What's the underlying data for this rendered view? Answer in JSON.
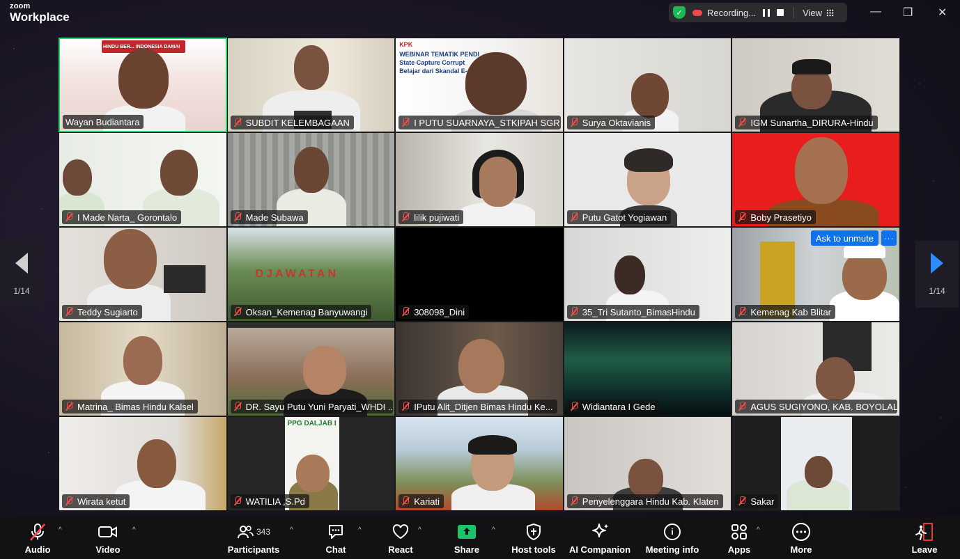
{
  "app": {
    "brand_top": "zoom",
    "brand_bottom": "Workplace"
  },
  "recording": {
    "status": "Recording...",
    "view_label": "View"
  },
  "window_controls": {
    "minimize": "—",
    "restore": "❐",
    "close": "✕"
  },
  "pager": {
    "left": "1/14",
    "right": "1/14"
  },
  "participants": [
    {
      "name": "Wayan Budiantara",
      "active": true,
      "muted": false
    },
    {
      "name": "SUBDIT KELEMBAGAAN",
      "muted": true
    },
    {
      "name": "I PUTU SUARNAYA_STKIPAH SGR",
      "muted": true
    },
    {
      "name": "Surya Oktavianis",
      "muted": true
    },
    {
      "name": "IGM Sunartha_DIRURA-Hindu",
      "muted": true
    },
    {
      "name": "I Made Narta_ Gorontalo",
      "muted": true
    },
    {
      "name": "Made Subawa",
      "muted": true
    },
    {
      "name": "lilik pujiwati",
      "muted": true
    },
    {
      "name": "Putu Gatot Yogiawan",
      "muted": true
    },
    {
      "name": "Boby Prasetiyo",
      "muted": true
    },
    {
      "name": "Teddy Sugiarto",
      "muted": true
    },
    {
      "name": "Oksan_Kemenag Banyuwangi",
      "muted": true
    },
    {
      "name": "308098_Dini",
      "muted": true
    },
    {
      "name": "35_Tri Sutanto_BimasHindu",
      "muted": true
    },
    {
      "name": "Kemenag Kab Blitar",
      "muted": true
    },
    {
      "name": "Matrina_ Bimas Hindu Kalsel",
      "muted": true
    },
    {
      "name": "DR. Sayu Putu Yuni Paryati_WHDI ...",
      "muted": true
    },
    {
      "name": "IPutu Alit_Ditjen Bimas Hindu Ke...",
      "muted": true
    },
    {
      "name": "Widiantara I Gede",
      "muted": true
    },
    {
      "name": "AGUS SUGIYONO, KAB. BOYOLALI",
      "muted": true
    },
    {
      "name": "Wirata ketut",
      "muted": true
    },
    {
      "name": "WATILIA ,S.Pd",
      "muted": true
    },
    {
      "name": "Kariati",
      "muted": true
    },
    {
      "name": "Penyelenggara Hindu Kab. Klaten",
      "muted": true
    },
    {
      "name": "Sakar",
      "muted": true
    }
  ],
  "tile_overlays": {
    "ask_unmute": "Ask to unmute",
    "more": "···",
    "kpk_line1": "KPK",
    "kpk_line2": "WEBINAR TEMATIK PENDI",
    "kpk_line3": "State Capture Corrupt",
    "kpk_line4": "Belajar dari Skandal E-",
    "ppg_text": "PPG DALJAB I",
    "park_sign": "DJAWATAN",
    "banner_text": "HINDU BER... INDONESIA DAMAI"
  },
  "toolbar": {
    "audio": "Audio",
    "video": "Video",
    "participants": "Participants",
    "participants_count": "343",
    "chat": "Chat",
    "react": "React",
    "share": "Share",
    "host_tools": "Host tools",
    "ai_companion": "AI Companion",
    "meeting_info": "Meeting info",
    "apps": "Apps",
    "more": "More",
    "leave": "Leave"
  },
  "colors": {
    "active_border": "#23d96c",
    "share_green": "#1bc36b",
    "accent_blue": "#0e72ed",
    "muted_red": "#ff4a4a"
  }
}
